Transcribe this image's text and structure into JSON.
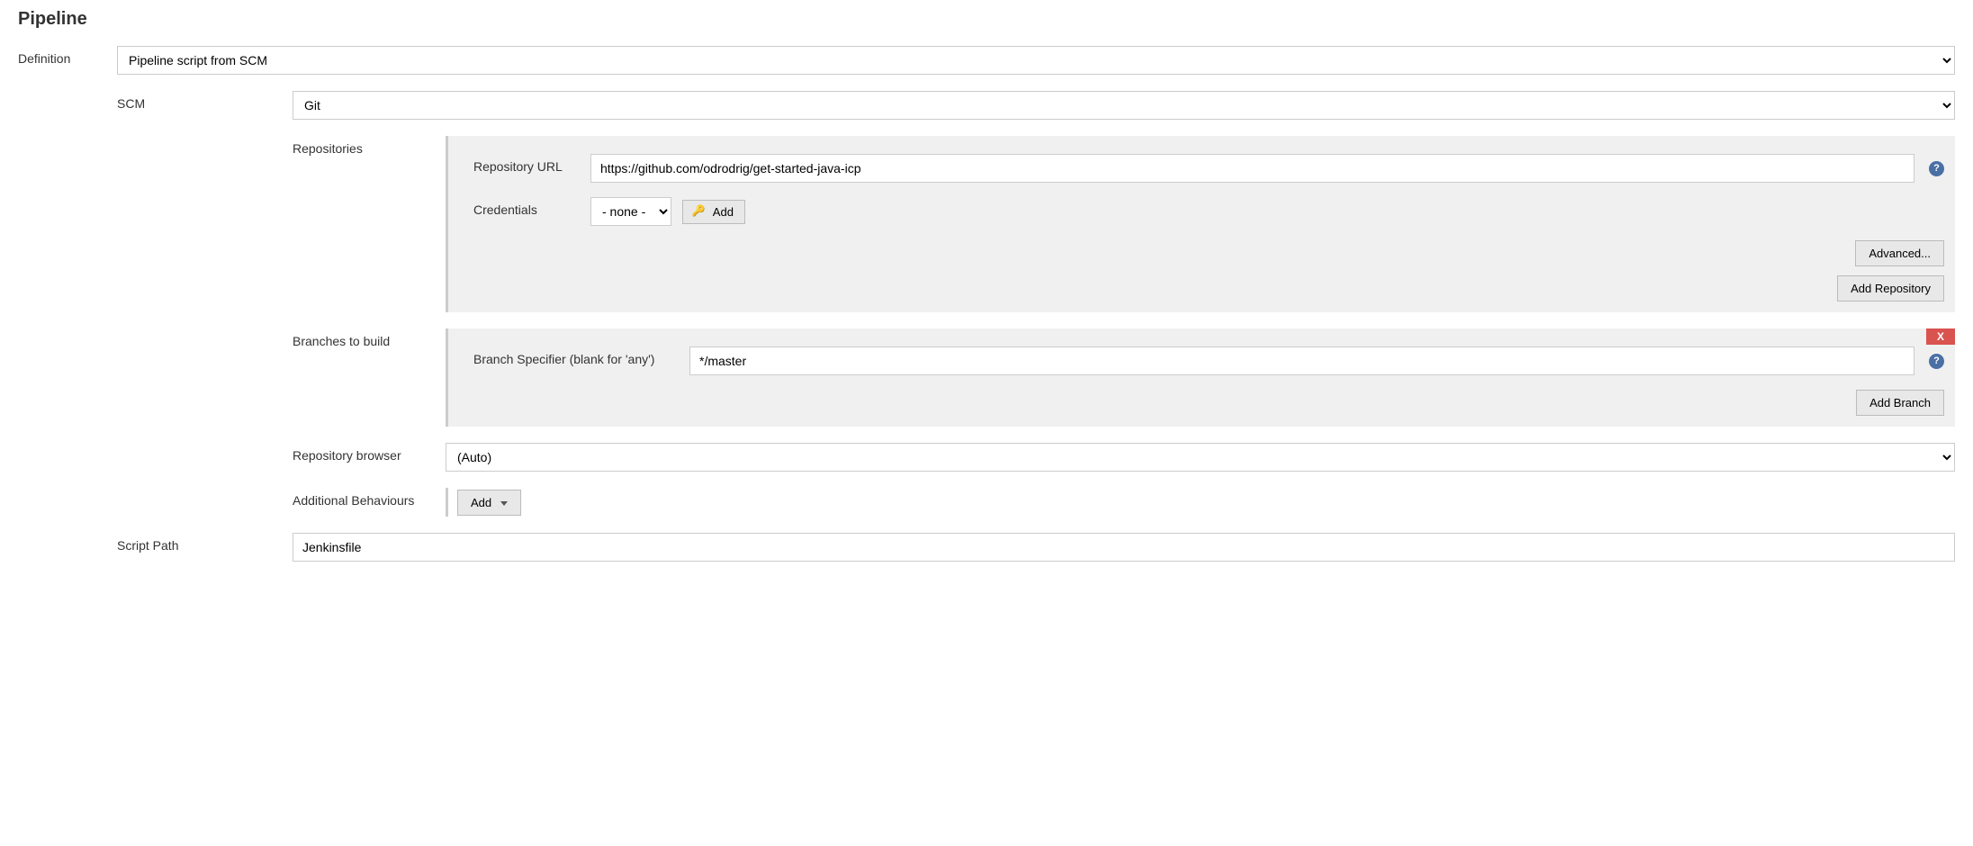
{
  "section_title": "Pipeline",
  "definition": {
    "label": "Definition",
    "value": "Pipeline script from SCM"
  },
  "scm": {
    "label": "SCM",
    "value": "Git"
  },
  "repositories": {
    "label": "Repositories",
    "url_label": "Repository URL",
    "url_value": "https://github.com/odrodrig/get-started-java-icp",
    "credentials_label": "Credentials",
    "credentials_value": "- none -",
    "add_cred_label": "Add",
    "advanced_label": "Advanced...",
    "add_repo_label": "Add Repository"
  },
  "branches": {
    "label": "Branches to build",
    "specifier_label": "Branch Specifier (blank for 'any')",
    "specifier_value": "*/master",
    "add_branch_label": "Add Branch",
    "delete_label": "X"
  },
  "repo_browser": {
    "label": "Repository browser",
    "value": "(Auto)"
  },
  "additional_behaviours": {
    "label": "Additional Behaviours",
    "add_label": "Add"
  },
  "script_path": {
    "label": "Script Path",
    "value": "Jenkinsfile"
  }
}
